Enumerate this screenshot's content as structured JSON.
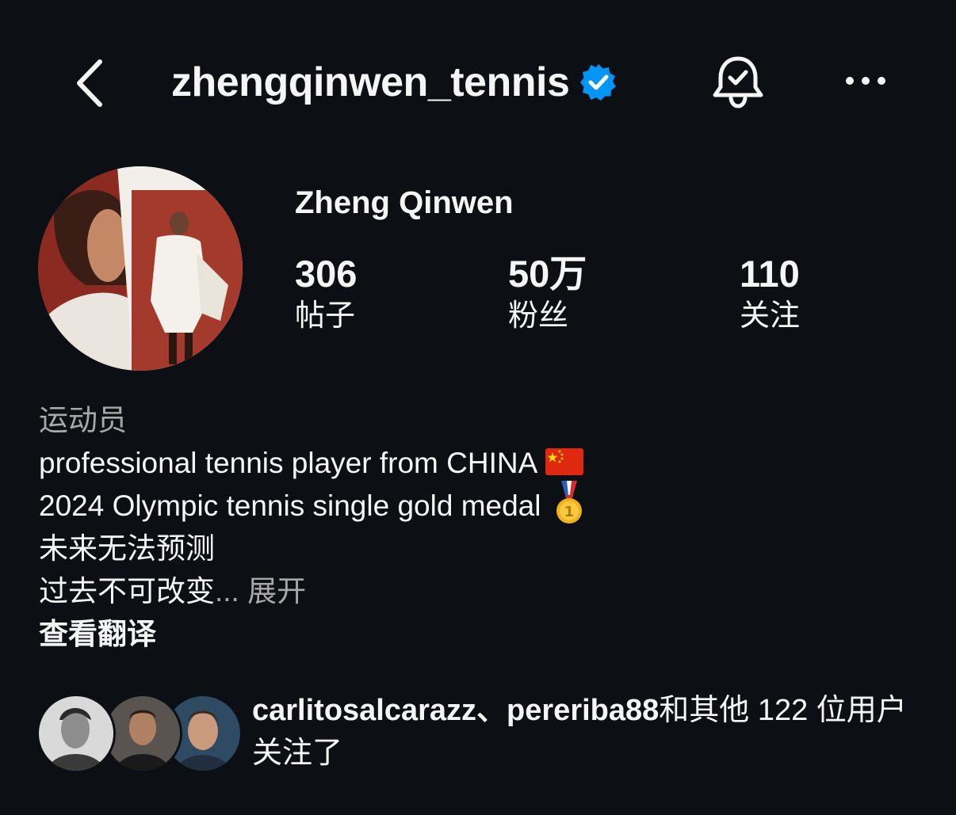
{
  "header": {
    "username": "zhengqinwen_tennis",
    "back_icon": "chevron-left-icon",
    "verified_icon": "verified-badge-icon",
    "bell_icon": "bell-check-icon",
    "more_icon": "more-horizontal-icon"
  },
  "profile": {
    "display_name": "Zheng Qinwen",
    "stats": [
      {
        "value": "306",
        "label": "帖子"
      },
      {
        "value": "50万",
        "label": "粉丝"
      },
      {
        "value": "110",
        "label": "关注"
      }
    ]
  },
  "bio": {
    "category": "运动员",
    "line1": "professional tennis player from CHINA",
    "line2": "2024 Olympic tennis single gold medal",
    "line3": "未来无法预测",
    "line4": "过去不可改变",
    "more": "... 展开",
    "translate": "查看翻译"
  },
  "followed_by": {
    "users": "carlitosalcarazz、pereriba88",
    "rest": "和其他 122 位用户关注了"
  },
  "colors": {
    "background": "#0c1014",
    "text": "#f5f5f5",
    "secondary": "#a8a8a8",
    "verified": "#0095f6"
  }
}
